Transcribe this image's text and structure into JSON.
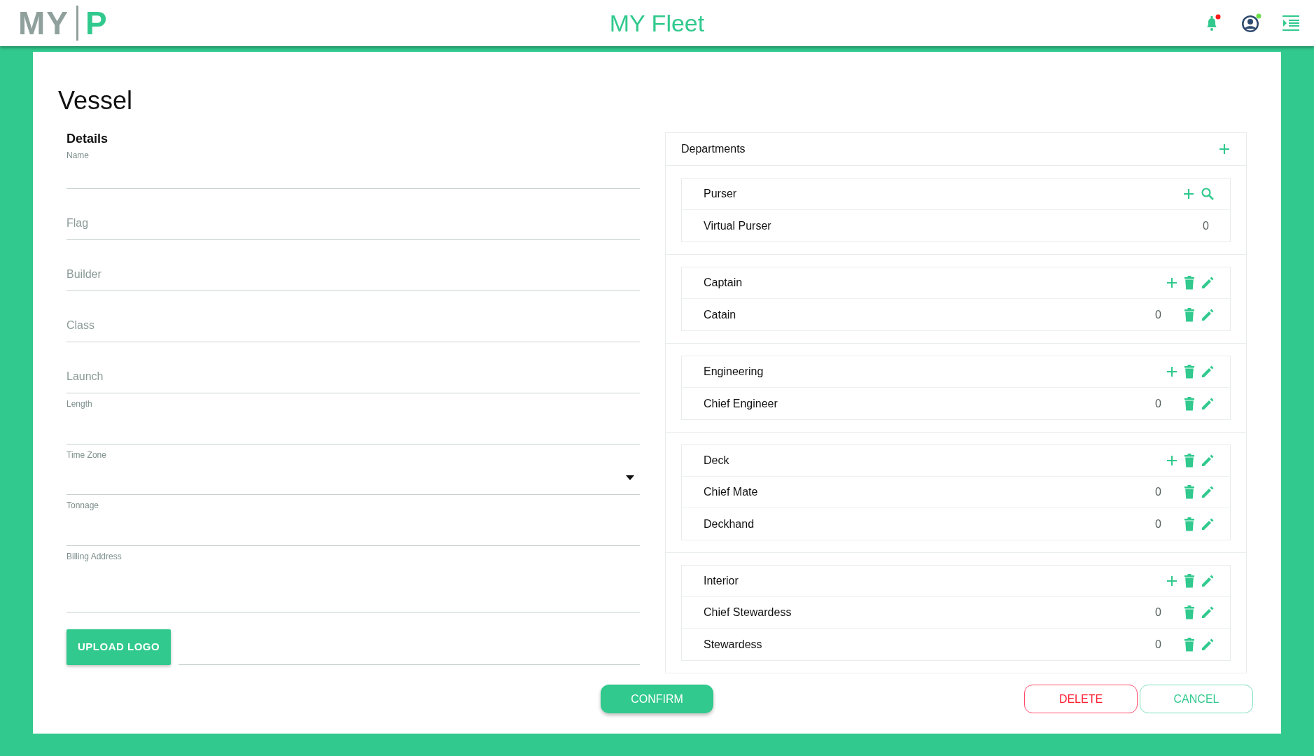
{
  "header": {
    "logo_left": "MY",
    "logo_right": "P",
    "title": "MY Fleet",
    "notifications_unread": true,
    "user_online": true
  },
  "page_title": "Vessel",
  "details": {
    "heading": "Details",
    "fields": [
      {
        "label": "Name",
        "kind": "floating"
      },
      {
        "placeholder": "Flag",
        "kind": "placeholder"
      },
      {
        "placeholder": "Builder",
        "kind": "placeholder"
      },
      {
        "placeholder": "Class",
        "kind": "placeholder"
      },
      {
        "placeholder": "Launch",
        "kind": "placeholder"
      },
      {
        "label": "Length",
        "kind": "floating"
      },
      {
        "label": "Time Zone",
        "kind": "select"
      },
      {
        "label": "Tonnage",
        "kind": "floating"
      },
      {
        "label": "Billing Address",
        "kind": "floating"
      }
    ],
    "upload_button": "UPLOAD LOGO"
  },
  "departments": {
    "title": "Departments",
    "groups": [
      {
        "name": "Purser",
        "addable": true,
        "searchable": true,
        "members": [
          {
            "name": "Virtual Purser",
            "count": "0"
          }
        ]
      },
      {
        "name": "Captain",
        "addable": true,
        "deletable": true,
        "editable": true,
        "members": [
          {
            "name": "Catain",
            "count": "0",
            "deletable": true,
            "editable": true
          }
        ]
      },
      {
        "name": "Engineering",
        "addable": true,
        "deletable": true,
        "editable": true,
        "members": [
          {
            "name": "Chief Engineer",
            "count": "0",
            "deletable": true,
            "editable": true
          }
        ]
      },
      {
        "name": "Deck",
        "addable": true,
        "deletable": true,
        "editable": true,
        "members": [
          {
            "name": "Chief Mate",
            "count": "0",
            "deletable": true,
            "editable": true
          },
          {
            "name": "Deckhand",
            "count": "0",
            "deletable": true,
            "editable": true
          }
        ]
      },
      {
        "name": "Interior",
        "addable": true,
        "deletable": true,
        "editable": true,
        "members": [
          {
            "name": "Chief Stewardess",
            "count": "0",
            "deletable": true,
            "editable": true
          },
          {
            "name": "Stewardess",
            "count": "0",
            "deletable": true,
            "editable": true
          }
        ]
      }
    ]
  },
  "buttons": [
    {
      "label": "CONFIRM",
      "kind": "primary"
    },
    {
      "label": "DELETE",
      "kind": "danger"
    },
    {
      "label": "CANCEL",
      "kind": "secondary"
    }
  ]
}
